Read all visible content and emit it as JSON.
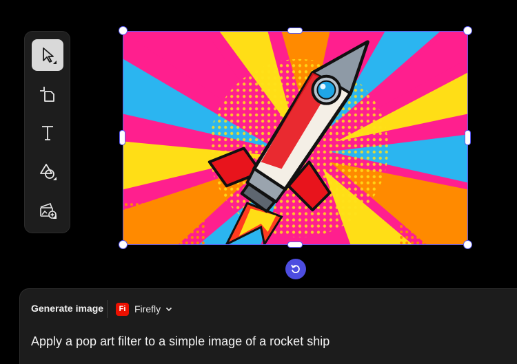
{
  "toolbar": {
    "tools": [
      {
        "name": "select",
        "icon": "cursor-arrow-icon",
        "active": true
      },
      {
        "name": "crop",
        "icon": "crop-shape-icon"
      },
      {
        "name": "text",
        "icon": "text-tool-icon",
        "label": "T"
      },
      {
        "name": "shapes",
        "icon": "shapes-icon"
      },
      {
        "name": "add-image",
        "icon": "add-image-icon"
      }
    ]
  },
  "canvas": {
    "image_subject": "pop art rocket ship",
    "selection_color": "#5b5bf0"
  },
  "panel": {
    "generate_label": "Generate image",
    "model_badge": "Fi",
    "model_name": "Firefly",
    "prompt_text": "Apply a pop art filter to a simple image of a rocket ship"
  },
  "colors": {
    "accent": "#4d4de0",
    "firefly_badge": "#eb1000"
  }
}
